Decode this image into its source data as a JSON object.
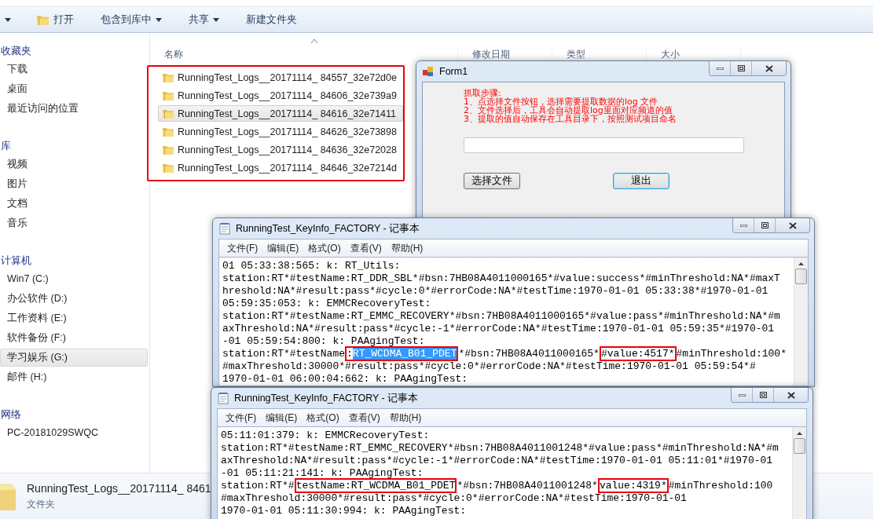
{
  "explorer": {
    "toolbar": [
      {
        "label": "打开",
        "kind": "open"
      },
      {
        "label": "包含到库中",
        "kind": "menu"
      },
      {
        "label": "共享",
        "kind": "menu"
      },
      {
        "label": "新建文件夹",
        "kind": "plain"
      }
    ],
    "sidebar": [
      {
        "label": "收藏夹",
        "items": [
          {
            "label": "下载",
            "selected": false
          },
          {
            "label": "桌面",
            "selected": false
          },
          {
            "label": "最近访问的位置",
            "selected": false
          }
        ]
      },
      {
        "label": "库",
        "items": [
          {
            "label": "视频",
            "selected": false
          },
          {
            "label": "图片",
            "selected": false
          },
          {
            "label": "文档",
            "selected": false
          },
          {
            "label": "音乐",
            "selected": false
          }
        ]
      },
      {
        "label": "计算机",
        "items": [
          {
            "label": "Win7 (C:)",
            "selected": false
          },
          {
            "label": "办公软件 (D:)",
            "selected": false
          },
          {
            "label": "工作资料 (E:)",
            "selected": false
          },
          {
            "label": "软件备份 (F:)",
            "selected": false
          },
          {
            "label": "学习娱乐 (G:)",
            "selected": true
          },
          {
            "label": "邮件 (H:)",
            "selected": false
          }
        ]
      },
      {
        "label": "网络",
        "items": [
          {
            "label": "PC-20181029SWQC",
            "selected": false
          }
        ]
      }
    ],
    "columns": [
      "名称",
      "修改日期",
      "类型",
      "大小"
    ],
    "files": [
      {
        "name": "RunningTest_Logs__20171114_ 84557_32e72d0e",
        "selected": false
      },
      {
        "name": "RunningTest_Logs__20171114_ 84606_32e739a9",
        "selected": false
      },
      {
        "name": "RunningTest_Logs__20171114_ 84616_32e71411",
        "selected": true
      },
      {
        "name": "RunningTest_Logs__20171114_ 84626_32e73898",
        "selected": false
      },
      {
        "name": "RunningTest_Logs__20171114_ 84636_32e72028",
        "selected": false
      },
      {
        "name": "RunningTest_Logs__20171114_ 84646_32e7214d",
        "selected": false
      }
    ],
    "details": {
      "name": "RunningTest_Logs__20171114_ 8461",
      "type": "文件夹"
    }
  },
  "form": {
    "title": "Form1",
    "instructions": [
      "抓取步骤:",
      "1、点选择文件按钮，选择需要提取数据的log 文件",
      "2、文件选择后，工具会自动提取log里面对应频道的值",
      "3、提取的值自动保存在工具目录下，按照测试项目命名"
    ],
    "buttons": [
      {
        "label": "选择文件",
        "focused": false
      },
      {
        "label": "退出",
        "focused": true
      }
    ]
  },
  "notepads": [
    {
      "title": "RunningTest_KeyInfo_FACTORY - 记事本",
      "menu": [
        "文件(F)",
        "编辑(E)",
        "格式(O)",
        "查看(V)",
        "帮助(H)"
      ],
      "lines": [
        [
          {
            "text": "01 05:33:38:565: k: RT_Utils:",
            "boxed": false,
            "selected": false
          }
        ],
        [
          {
            "text": "station:RT*#testName:RT_DDR_SBL*#bsn:7HB08A4011000165*#value:success*#minThreshold:NA*#maxT",
            "boxed": false,
            "selected": false
          }
        ],
        [
          {
            "text": "hreshold:NA*#result:pass*#cycle:0*#errorCode:NA*#testTime:1970-01-01 05:33:38*#1970-01-01",
            "boxed": false,
            "selected": false
          }
        ],
        [
          {
            "text": "05:59:35:053: k: EMMCRecoveryTest:",
            "boxed": false,
            "selected": false
          }
        ],
        [
          {
            "text": "station:RT*#testName:RT_EMMC_RECOVERY*#bsn:7HB08A4011000165*#value:pass*#minThreshold:NA*#m",
            "boxed": false,
            "selected": false
          }
        ],
        [
          {
            "text": "axThreshold:NA*#result:pass*#cycle:-1*#errorCode:NA*#testTime:1970-01-01 05:59:35*#1970-01",
            "boxed": false,
            "selected": false
          }
        ],
        [
          {
            "text": "-01 05:59:54:800: k: PAAgingTest:",
            "boxed": false,
            "selected": false
          }
        ],
        [
          {
            "text": "station:RT*#testName",
            "boxed": false,
            "selected": false
          },
          {
            "text": ":",
            "boxed": true,
            "selected": false
          },
          {
            "text": "RT_WCDMA_B01_PDET",
            "boxed": true,
            "selected": true
          },
          {
            "text": "*#bsn:7HB08A4011000165*",
            "boxed": false,
            "selected": false
          },
          {
            "text": "#value:4517*",
            "boxed": true,
            "selected": false
          },
          {
            "text": "#minThreshold:100*",
            "boxed": false,
            "selected": false
          }
        ],
        [
          {
            "text": "#maxThreshold:30000*#result:pass*#cycle:0*#errorCode:NA*#testTime:1970-01-01 05:59:54*#",
            "boxed": false,
            "selected": false
          }
        ],
        [
          {
            "text": "1970-01-01 06:00:04:662: k: PAAgingTest:",
            "boxed": false,
            "selected": false
          }
        ]
      ]
    },
    {
      "title": "RunningTest_KeyInfo_FACTORY - 记事本",
      "menu": [
        "文件(F)",
        "编辑(E)",
        "格式(O)",
        "查看(V)",
        "帮助(H)"
      ],
      "lines": [
        [
          {
            "text": "05:11:01:379: k: EMMCRecoveryTest:",
            "boxed": false,
            "selected": false
          }
        ],
        [
          {
            "text": "station:RT*#testName:RT_EMMC_RECOVERY*#bsn:7HB08A4011001248*#value:pass*#minThreshold:NA*#m",
            "boxed": false,
            "selected": false
          }
        ],
        [
          {
            "text": "axThreshold:NA*#result:pass*#cycle:-1*#errorCode:NA*#testTime:1970-01-01 05:11:01*#1970-01",
            "boxed": false,
            "selected": false
          }
        ],
        [
          {
            "text": "-01 05:11:21:141: k: PAAgingTest:",
            "boxed": false,
            "selected": false
          }
        ],
        [
          {
            "text": "station:RT*#",
            "boxed": false,
            "selected": false
          },
          {
            "text": "testName:RT_WCDMA_B01_PDET",
            "boxed": true,
            "selected": false
          },
          {
            "text": "*#bsn:7HB08A4011001248*",
            "boxed": false,
            "selected": false
          },
          {
            "text": "value:4319*",
            "boxed": true,
            "selected": false
          },
          {
            "text": "#minThreshold:100",
            "boxed": false,
            "selected": false
          }
        ],
        [
          {
            "text": "#maxThreshold:30000*#result:pass*#cycle:0*#errorCode:NA*#testTime:1970-01-01",
            "boxed": false,
            "selected": false
          }
        ],
        [
          {
            "text": "1970-01-01 05:11:30:994: k: PAAgingTest:",
            "boxed": false,
            "selected": false
          }
        ]
      ]
    }
  ]
}
